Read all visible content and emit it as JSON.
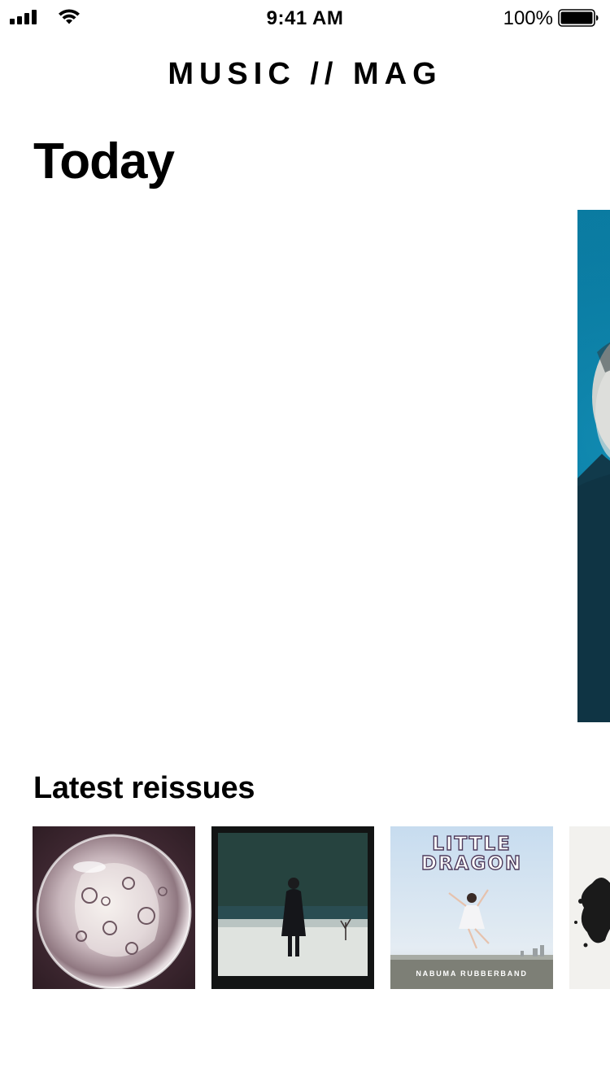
{
  "status_bar": {
    "time": "9:41 AM",
    "battery_percent": "100%",
    "battery_level": 1.0,
    "icons": [
      "signal-bars-icon",
      "wifi-icon",
      "battery-icon"
    ]
  },
  "header": {
    "brand": "MUSIC // MAG"
  },
  "page": {
    "title": "Today"
  },
  "featured": {
    "colors": {
      "card_background": "#0a7aa0",
      "figure": "#0f3b4c"
    }
  },
  "reissues": {
    "title": "Latest reissues",
    "albums": [
      {
        "artwork": "glass-orb-artwork"
      },
      {
        "artwork": "figure-in-snow-artwork"
      },
      {
        "artwork": "little-dragon-artwork",
        "title_lines": [
          "LITTLE",
          "DRAGON"
        ],
        "subtitle": "NABUMA RUBBERBAND"
      },
      {
        "artwork": "ink-splatter-artwork"
      }
    ]
  }
}
